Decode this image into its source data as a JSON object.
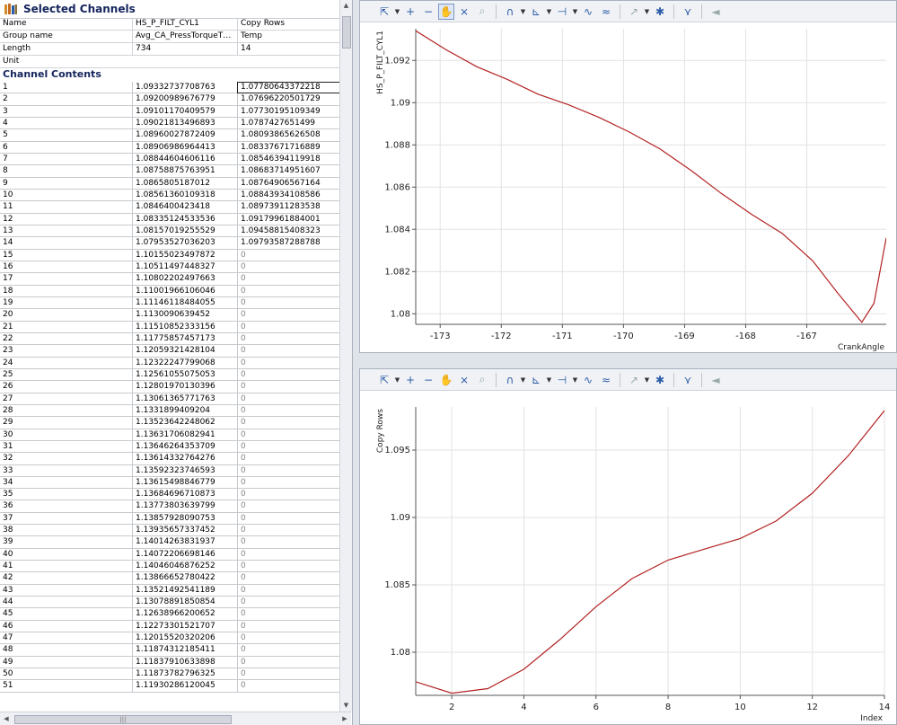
{
  "left": {
    "title": "Selected Channels",
    "meta": [
      {
        "key": "Name",
        "v1": "HS_P_FILT_CYL1",
        "v2": "Copy Rows"
      },
      {
        "key": "Group name",
        "v1": "Avg_CA_PressTorqueT…",
        "v2": "Temp"
      },
      {
        "key": "Length",
        "v1": "734",
        "v2": "14"
      },
      {
        "key": "Unit",
        "v1": "",
        "v2": ""
      }
    ],
    "contents_title": "Channel Contents",
    "rows": [
      [
        "1",
        "1.09332737708763",
        "1.07780643372218"
      ],
      [
        "2",
        "1.09200989676779",
        "1.07696220501729"
      ],
      [
        "3",
        "1.09101170409579",
        "1.07730195109349"
      ],
      [
        "4",
        "1.09021813496893",
        "1.0787427651499"
      ],
      [
        "5",
        "1.08960027872409",
        "1.08093865626508"
      ],
      [
        "6",
        "1.08906986964413",
        "1.08337671716889"
      ],
      [
        "7",
        "1.08844604606116",
        "1.08546394119918"
      ],
      [
        "8",
        "1.08758875763951",
        "1.08683714951607"
      ],
      [
        "9",
        "1.0865805187012",
        "1.08764906567164"
      ],
      [
        "10",
        "1.08561360109318",
        "1.08843934108586"
      ],
      [
        "11",
        "1.0846400423418",
        "1.08973911283538"
      ],
      [
        "12",
        "1.08335124533536",
        "1.09179961884001"
      ],
      [
        "13",
        "1.08157019255529",
        "1.09458815408323"
      ],
      [
        "14",
        "1.07953527036203",
        "1.09793587288788"
      ],
      [
        "15",
        "1.10155023497872",
        "0"
      ],
      [
        "16",
        "1.10511497448327",
        "0"
      ],
      [
        "17",
        "1.10802202497663",
        "0"
      ],
      [
        "18",
        "1.11001966106046",
        "0"
      ],
      [
        "19",
        "1.11146118484055",
        "0"
      ],
      [
        "20",
        "1.1130090639452",
        "0"
      ],
      [
        "21",
        "1.11510852333156",
        "0"
      ],
      [
        "22",
        "1.11775857457173",
        "0"
      ],
      [
        "23",
        "1.12059321428104",
        "0"
      ],
      [
        "24",
        "1.12322247799068",
        "0"
      ],
      [
        "25",
        "1.12561055075053",
        "0"
      ],
      [
        "26",
        "1.12801970130396",
        "0"
      ],
      [
        "27",
        "1.13061365771763",
        "0"
      ],
      [
        "28",
        "1.1331899409204",
        "0"
      ],
      [
        "29",
        "1.13523642248062",
        "0"
      ],
      [
        "30",
        "1.13631706082941",
        "0"
      ],
      [
        "31",
        "1.13646264353709",
        "0"
      ],
      [
        "32",
        "1.13614332764276",
        "0"
      ],
      [
        "33",
        "1.13592323746593",
        "0"
      ],
      [
        "34",
        "1.13615498846779",
        "0"
      ],
      [
        "35",
        "1.13684696710873",
        "0"
      ],
      [
        "36",
        "1.13773803639799",
        "0"
      ],
      [
        "37",
        "1.13857928090753",
        "0"
      ],
      [
        "38",
        "1.13935657337452",
        "0"
      ],
      [
        "39",
        "1.14014263831937",
        "0"
      ],
      [
        "40",
        "1.14072206698146",
        "0"
      ],
      [
        "41",
        "1.14046046876252",
        "0"
      ],
      [
        "42",
        "1.13866652780422",
        "0"
      ],
      [
        "43",
        "1.13521492541189",
        "0"
      ],
      [
        "44",
        "1.13078891850854",
        "0"
      ],
      [
        "45",
        "1.12638966200652",
        "0"
      ],
      [
        "46",
        "1.12273301521707",
        "0"
      ],
      [
        "47",
        "1.12015520320206",
        "0"
      ],
      [
        "48",
        "1.11874312185411",
        "0"
      ],
      [
        "49",
        "1.11837910633898",
        "0"
      ],
      [
        "50",
        "1.11873782796325",
        "0"
      ],
      [
        "51",
        "1.11930286120045",
        "0"
      ]
    ],
    "selected_row": 0
  },
  "toolbar_icons": [
    "cursor-options-icon",
    "zoom-in-icon",
    "zoom-out-icon",
    "pan-hand-icon",
    "zoom-reset-icon",
    "zoom-tool-icon",
    "curve-style-icon",
    "axis-options-icon",
    "marker-icon",
    "series-a-icon",
    "series-b-icon",
    "trend-icon",
    "pin-icon",
    "fit-icon",
    "mute-icon"
  ],
  "chart_data": [
    {
      "type": "line",
      "title": "",
      "xlabel": "CrankAngle",
      "ylabel": "HS_P_FILT_CYL1",
      "xlim": [
        -173.4,
        -165.7
      ],
      "ylim": [
        1.0795,
        1.0935
      ],
      "xticks": [
        -173,
        -172,
        -171,
        -170,
        -169,
        -168,
        -167
      ],
      "yticks": [
        1.08,
        1.082,
        1.084,
        1.086,
        1.088,
        1.09,
        1.092
      ],
      "xticklabels": [
        "-173",
        "-172",
        "-171",
        "-170",
        "-169",
        "-168",
        "-167"
      ],
      "yticklabels": [
        "1.08",
        "1.082",
        "1.084",
        "1.086",
        "1.088",
        "1.09",
        "1.092"
      ],
      "series": [
        {
          "color": "#b22222",
          "x": [
            -173.4,
            -172.9,
            -172.4,
            -171.9,
            -171.4,
            -170.9,
            -170.4,
            -169.9,
            -169.4,
            -168.9,
            -168.4,
            -167.9,
            -167.4,
            -166.9,
            -166.5,
            -166.1,
            -165.9,
            -165.7
          ],
          "y": [
            1.0934,
            1.0925,
            1.0917,
            1.0911,
            1.0904,
            1.0899,
            1.0893,
            1.0886,
            1.0878,
            1.0868,
            1.0857,
            1.0847,
            1.0838,
            1.0825,
            1.081,
            1.0796,
            1.0805,
            1.0836
          ]
        }
      ]
    },
    {
      "type": "line",
      "title": "",
      "xlabel": "Index",
      "ylabel": "Copy Rows",
      "xlim": [
        1,
        14
      ],
      "ylim": [
        1.0768,
        1.0982
      ],
      "xticks": [
        2,
        4,
        6,
        8,
        10,
        12,
        14
      ],
      "yticks": [
        1.08,
        1.085,
        1.09,
        1.095
      ],
      "xticklabels": [
        "2",
        "4",
        "6",
        "8",
        "10",
        "12",
        "14"
      ],
      "yticklabels": [
        "1.08",
        "1.085",
        "1.09",
        "1.095"
      ],
      "series": [
        {
          "color": "#b22222",
          "x": [
            1,
            2,
            3,
            4,
            5,
            6,
            7,
            8,
            9,
            10,
            11,
            12,
            13,
            14
          ],
          "y": [
            1.07780643372218,
            1.07696220501729,
            1.07730195109349,
            1.0787427651499,
            1.08093865626508,
            1.08337671716889,
            1.08546394119918,
            1.08683714951607,
            1.08764906567164,
            1.08843934108586,
            1.08973911283538,
            1.09179961884001,
            1.09458815408323,
            1.09793587288788
          ]
        }
      ]
    }
  ]
}
